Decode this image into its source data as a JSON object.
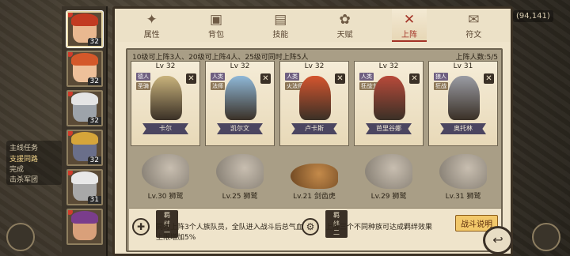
{
  "coords": "(94,141)",
  "left_hud": {
    "quest_title": "主线任务",
    "quest_line1": "支援同路",
    "quest_line2": "完成",
    "quest_line3": "击杀军团"
  },
  "heroes": [
    {
      "lv": "32",
      "hair": "#c23b22",
      "face": "#e9b890"
    },
    {
      "lv": "32",
      "hair": "#d4582a",
      "face": "#eec09a"
    },
    {
      "lv": "32",
      "hair": "#e4e4e4",
      "face": "#9da3aa"
    },
    {
      "lv": "32",
      "hair": "#d6a53a",
      "face": "#6a6f8a"
    },
    {
      "lv": "31",
      "hair": "#e8e8e8",
      "face": "#a8a8a8"
    },
    {
      "lv": "",
      "hair": "#7a3d8c",
      "face": "#d9a07a"
    }
  ],
  "tabs": [
    {
      "icon": "✦",
      "label": "属性"
    },
    {
      "icon": "▣",
      "label": "背包"
    },
    {
      "icon": "▤",
      "label": "技能"
    },
    {
      "icon": "✿",
      "label": "天赋"
    },
    {
      "icon": "✕",
      "label": "上阵"
    },
    {
      "icon": "✉",
      "label": "符文"
    }
  ],
  "info_text": "10级可上阵3人、20级可上阵4人、25级可同时上阵5人",
  "count_text": "上阵人数:5/5",
  "cards": [
    {
      "lv": "Lv 32",
      "tag1": "德人",
      "tag2": "圣骑",
      "name": "卡尔",
      "color": "#c9b37c"
    },
    {
      "lv": "Lv 32",
      "tag1": "人类",
      "tag2": "法师",
      "name": "凯尔文",
      "color": "#8fb8d8"
    },
    {
      "lv": "Lv 32",
      "tag1": "人类",
      "tag2": "火法师",
      "name": "卢卡斯",
      "color": "#d4552e"
    },
    {
      "lv": "Lv 32",
      "tag1": "人类",
      "tag2": "狂战士",
      "name": "芭里谷娜",
      "color": "#b84a3a"
    },
    {
      "lv": "Lv 31",
      "tag1": "狼人",
      "tag2": "狂战",
      "name": "奥托林",
      "color": "#9a9ca4"
    }
  ],
  "pets": [
    {
      "label": "Lv.30 狮鹫",
      "kind": "griffin"
    },
    {
      "label": "Lv.25 狮鹫",
      "kind": "griffin"
    },
    {
      "label": "Lv.21 剑齿虎",
      "kind": "tiger"
    },
    {
      "label": "Lv.29 狮鹫",
      "kind": "griffin"
    },
    {
      "label": "Lv.31 狮鹫",
      "kind": "griffin"
    }
  ],
  "bond1": {
    "title": "羁绊一",
    "text": "同时上阵3个人族队员，全队进入战斗后总气血上限增加5%"
  },
  "bond2": {
    "title": "羁绊二",
    "text": "上阵三个不同种族可达成羁绊效果"
  },
  "help_label": "战斗说明",
  "back_icon": "↩"
}
